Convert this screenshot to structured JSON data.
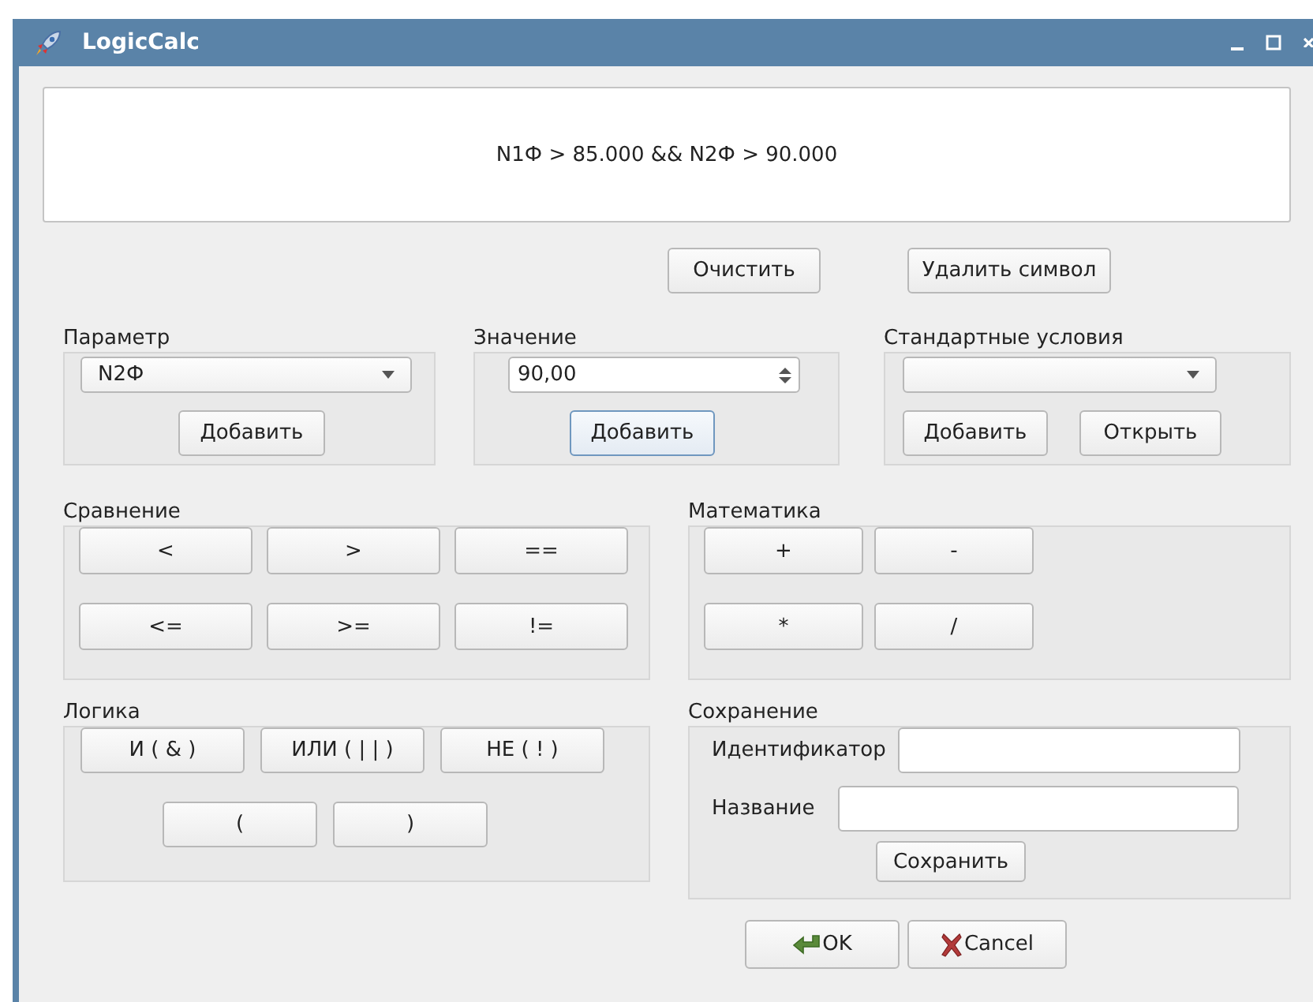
{
  "window": {
    "title": "LogicCalc"
  },
  "expression": "N1Ф > 85.000 && N2Ф > 90.000",
  "edit_buttons": [
    {
      "label": "Очистить"
    },
    {
      "label": "Удалить символ"
    }
  ],
  "parameter": {
    "label": "Параметр",
    "value": "N2Ф",
    "button": {
      "label": "Добавить",
      "focused": false
    }
  },
  "value": {
    "label": "Значение",
    "value": "90,00",
    "button": {
      "label": "Добавить",
      "focused": true
    }
  },
  "standard_conditions": {
    "label": "Стандартные условия",
    "buttons": [
      {
        "label": "Добавить",
        "focused": false
      },
      {
        "label": "Открыть",
        "focused": false
      }
    ]
  },
  "comparison": {
    "label": "Сравнение",
    "buttons": [
      "<",
      ">",
      "==",
      "<=",
      ">=",
      "!="
    ]
  },
  "math": {
    "label": "Математика",
    "buttons": [
      "+",
      "-",
      "*",
      "/"
    ]
  },
  "logic": {
    "label": "Логика",
    "buttons": [
      "И ( & )",
      "ИЛИ ( | | )",
      "НЕ ( ! )",
      "(",
      ")"
    ]
  },
  "saving": {
    "label": "Сохранение",
    "fields": [
      {
        "label": "Идентификатор"
      },
      {
        "label": "Название"
      }
    ],
    "button": "Сохранить"
  },
  "dialog_buttons": [
    {
      "kind": "ok",
      "label": "OK"
    },
    {
      "kind": "cancel",
      "label": "Cancel"
    }
  ]
}
